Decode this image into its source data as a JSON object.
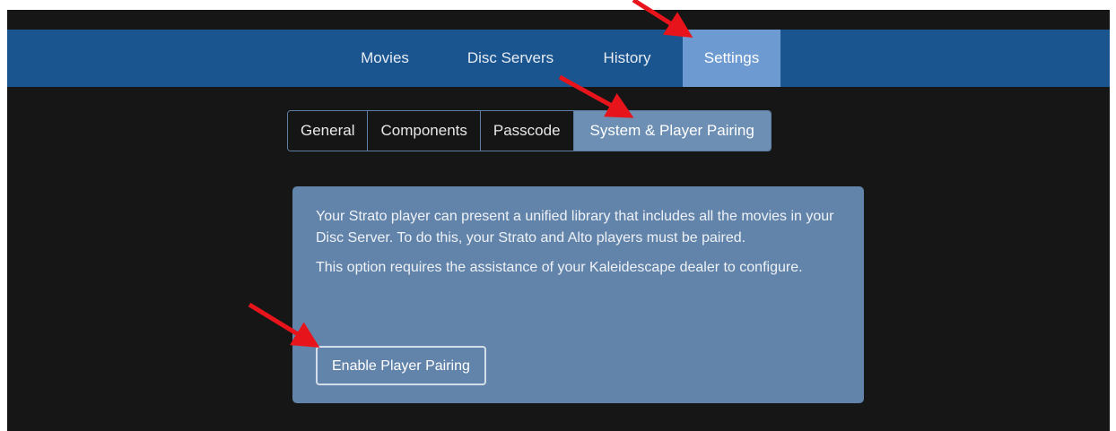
{
  "nav": {
    "tabs": [
      {
        "label": "Movies"
      },
      {
        "label": "Disc Servers"
      },
      {
        "label": "History"
      },
      {
        "label": "Settings",
        "active": true
      }
    ]
  },
  "subtabs": [
    {
      "label": "General"
    },
    {
      "label": "Components"
    },
    {
      "label": "Passcode"
    },
    {
      "label": "System & Player Pairing",
      "active": true
    }
  ],
  "panel": {
    "paragraph1": "Your Strato player can present a unified library that includes all the movies in your Disc Server. To do this, your Strato and Alto players must be paired.",
    "paragraph2": "This option requires the assistance of your Kaleidescape dealer to configure.",
    "button_label": "Enable Player Pairing"
  },
  "colors": {
    "nav_bar": "#1b5590",
    "nav_active": "#6d9ad0",
    "panel": "#6384aa",
    "background": "#161616",
    "annotation_arrow": "#e8141b"
  }
}
